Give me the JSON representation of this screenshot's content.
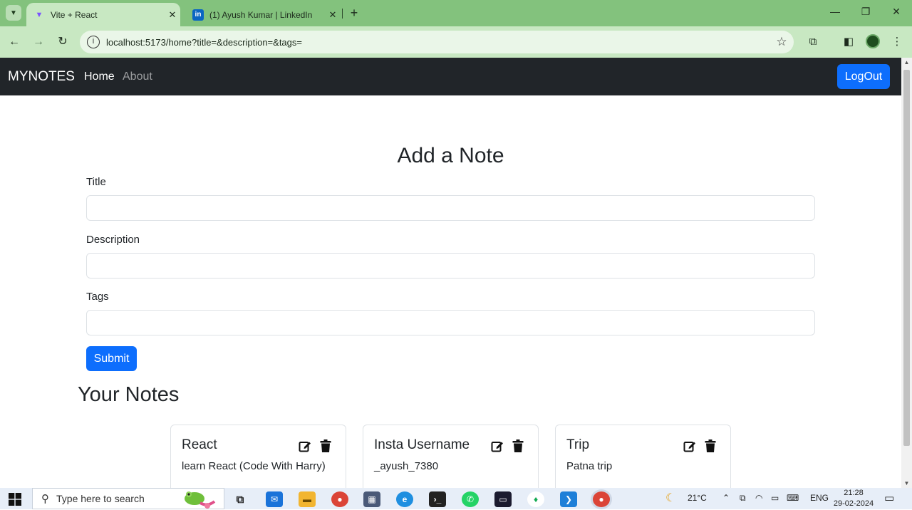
{
  "browser": {
    "tabs": [
      {
        "title": "Vite + React",
        "active": true
      },
      {
        "title": "(1) Ayush Kumar | LinkedIn",
        "active": false
      }
    ],
    "url": "localhost:5173/home?title=&description=&tags="
  },
  "navbar": {
    "brand": "MYNOTES",
    "links": [
      "Home",
      "About"
    ],
    "logout_label": "LogOut"
  },
  "form": {
    "heading": "Add a Note",
    "title_label": "Title",
    "title_value": "",
    "description_label": "Description",
    "description_value": "",
    "tags_label": "Tags",
    "tags_value": "",
    "submit_label": "Submit"
  },
  "notes": {
    "heading": "Your Notes",
    "items": [
      {
        "title": "React",
        "description": "learn React (Code With Harry)"
      },
      {
        "title": "Insta Username",
        "description": "_ayush_7380"
      },
      {
        "title": "Trip",
        "description": "Patna trip"
      }
    ]
  },
  "taskbar": {
    "search_placeholder": "Type here to search",
    "weather": "21°C",
    "language": "ENG",
    "time": "21:28",
    "date": "29-02-2024"
  },
  "colors": {
    "primary": "#0d6efd",
    "navbar_bg": "#212529",
    "browser_frame": "#83c27d"
  }
}
